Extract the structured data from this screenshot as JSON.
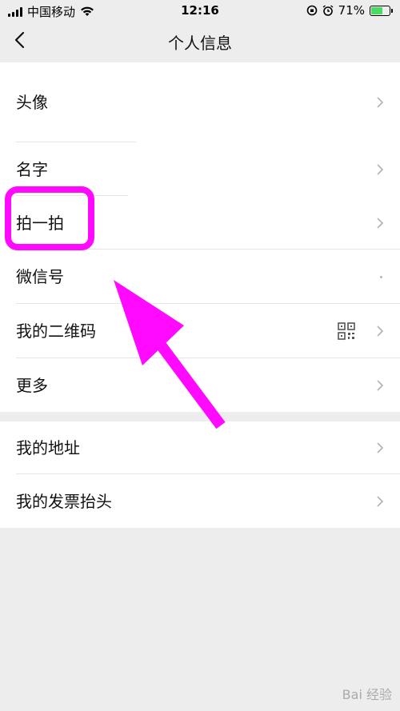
{
  "status_bar": {
    "carrier": "中国移动",
    "time": "12:16",
    "battery_percent": "71%",
    "battery_level": 0.71
  },
  "nav": {
    "title": "个人信息",
    "back_icon": "chevron-left-icon"
  },
  "group1": {
    "rows": [
      {
        "label": "头像"
      },
      {
        "label": "名字"
      },
      {
        "label": "拍一拍"
      },
      {
        "label": "微信号"
      },
      {
        "label": "我的二维码"
      },
      {
        "label": "更多"
      }
    ]
  },
  "group2": {
    "rows": [
      {
        "label": "我的地址"
      },
      {
        "label": "我的发票抬头"
      }
    ]
  },
  "annotation": {
    "color": "#ff0aff"
  },
  "watermark": {
    "text": "Bai 经验"
  }
}
